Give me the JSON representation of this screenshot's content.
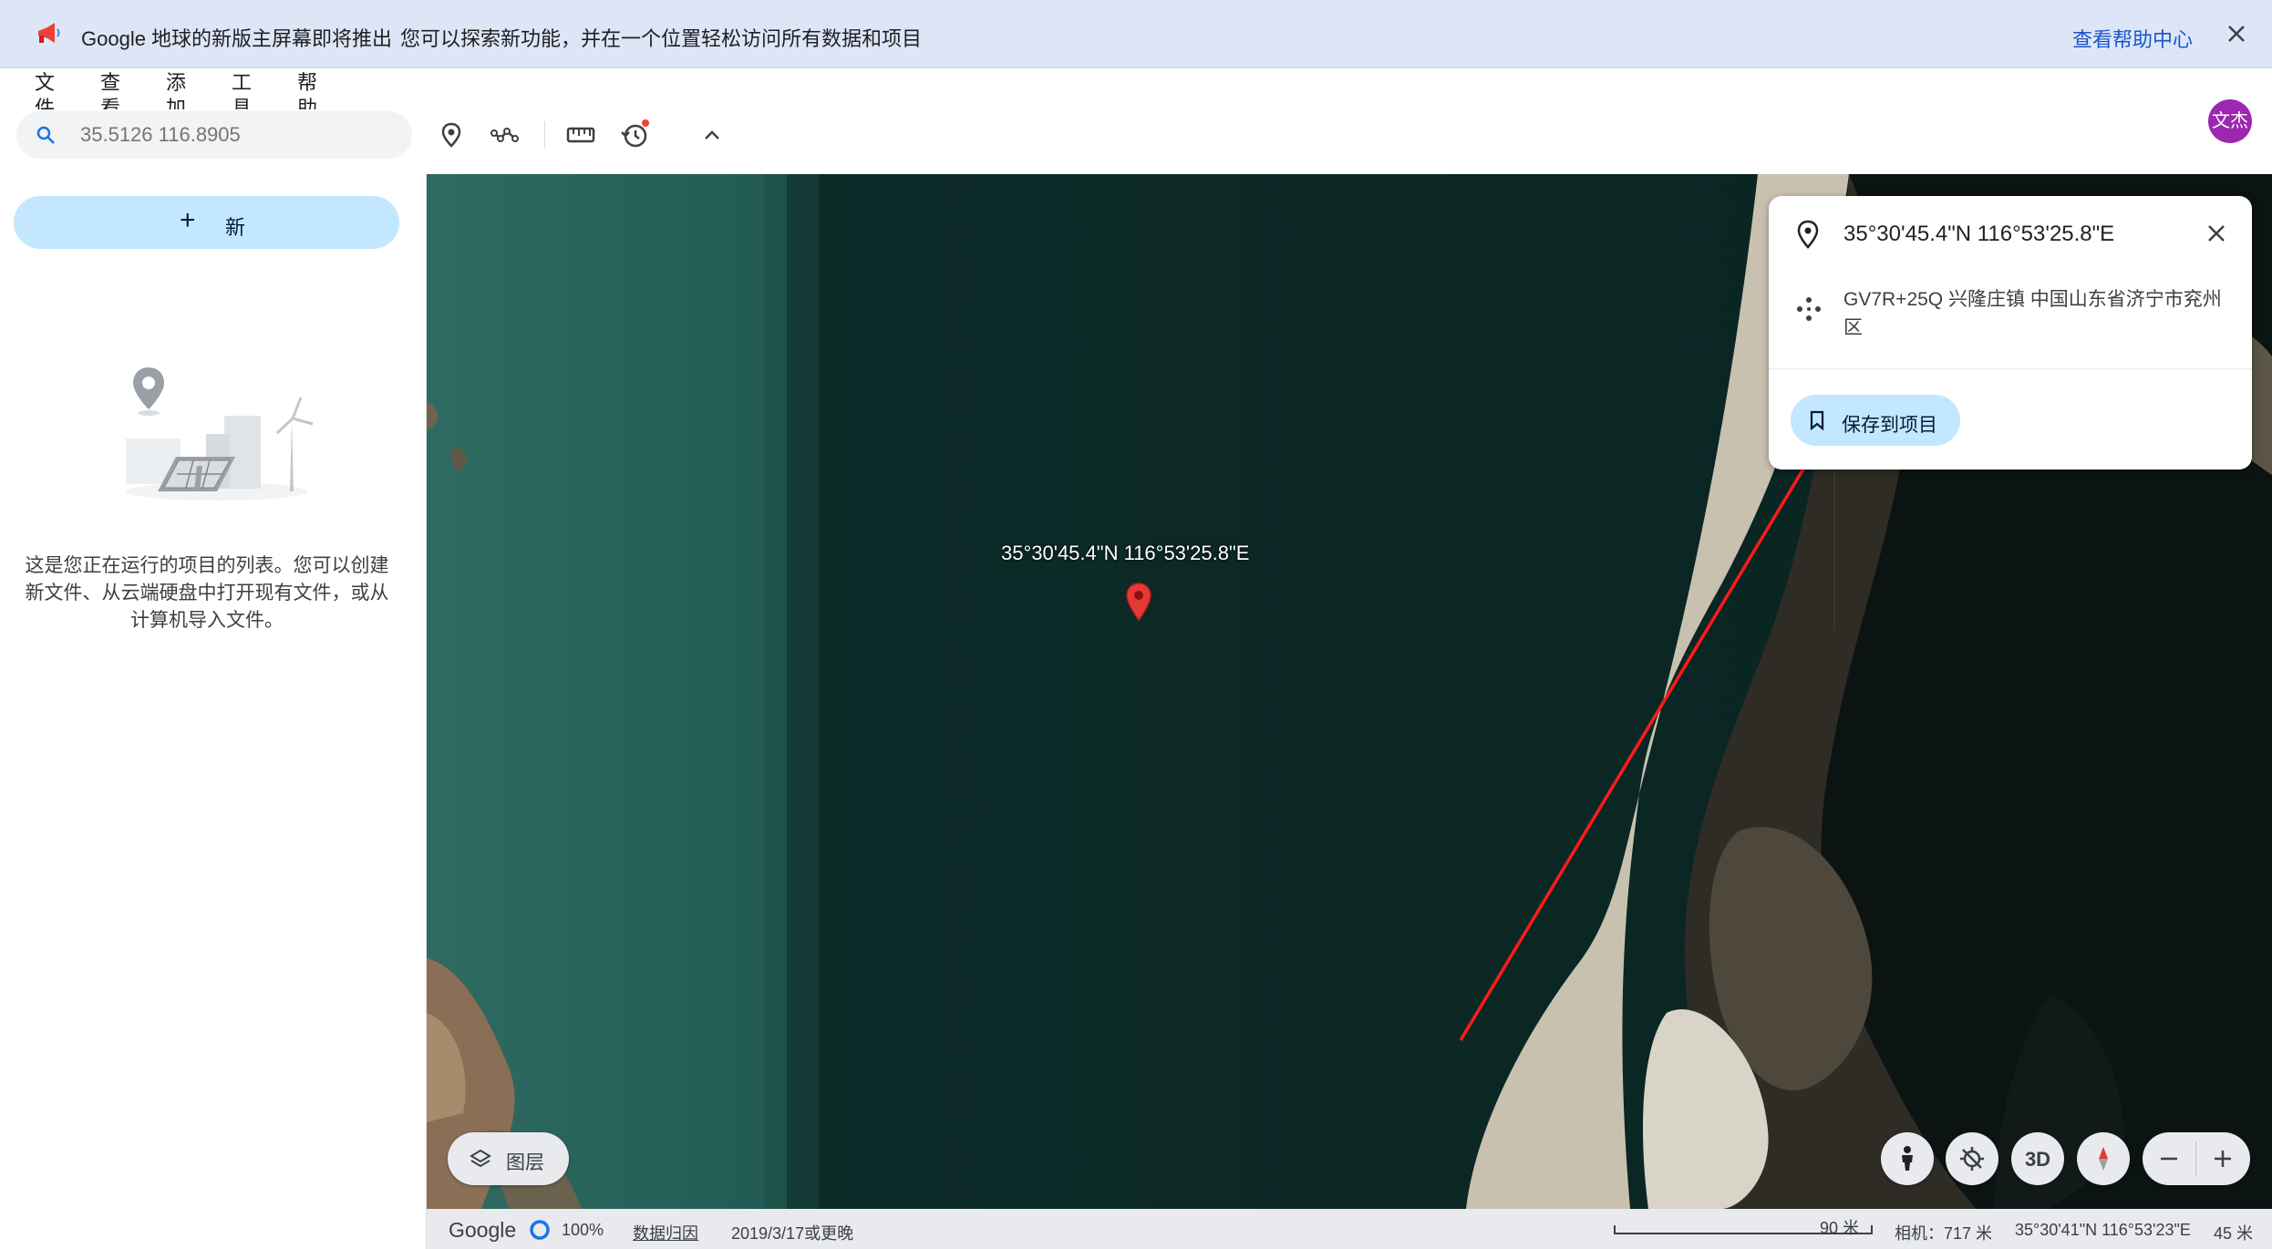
{
  "banner": {
    "brand": "Google 地球的新版主屏幕即将推出",
    "message": "您可以探索新功能，并在一个位置轻松访问所有数据和项目",
    "help_link": "查看帮助中心"
  },
  "menu": {
    "items": [
      "文件",
      "查看",
      "添加",
      "工具",
      "帮助"
    ]
  },
  "search": {
    "placeholder": "35.5126 116.8905"
  },
  "user": {
    "avatar_text": "文杰"
  },
  "sidebar": {
    "new_button": "新",
    "empty_text": "这是您正在运行的项目的列表。您可以创建新文件、从云端硬盘中打开现有文件，或从计算机导入文件。"
  },
  "map": {
    "pin_label": "35°30'45.4\"N 116°53'25.8\"E",
    "layers_label": "图层",
    "btn_3d": "3D"
  },
  "info_card": {
    "coordinates": "35°30'45.4\"N 116°53'25.8\"E",
    "plus_code": "GV7R+25Q 兴隆庄镇 中国山东省济宁市兖州区",
    "save_button": "保存到项目"
  },
  "status": {
    "logo": "Google",
    "load_percent": "100%",
    "attribution": "数据归因",
    "imagery_date": "2019/3/17或更晚",
    "scale": "90 米",
    "camera": "相机：717 米",
    "cursor_coords": "35°30'41\"N 116°53'23\"E",
    "elevation": "45 米"
  },
  "colors": {
    "banner_bg": "#dde6f7",
    "accent_button": "#c2e7ff",
    "link": "#1a56c9",
    "avatar": "#9c27b0",
    "pin": "#e53935",
    "annotation_arrow": "#ff1a1a"
  }
}
